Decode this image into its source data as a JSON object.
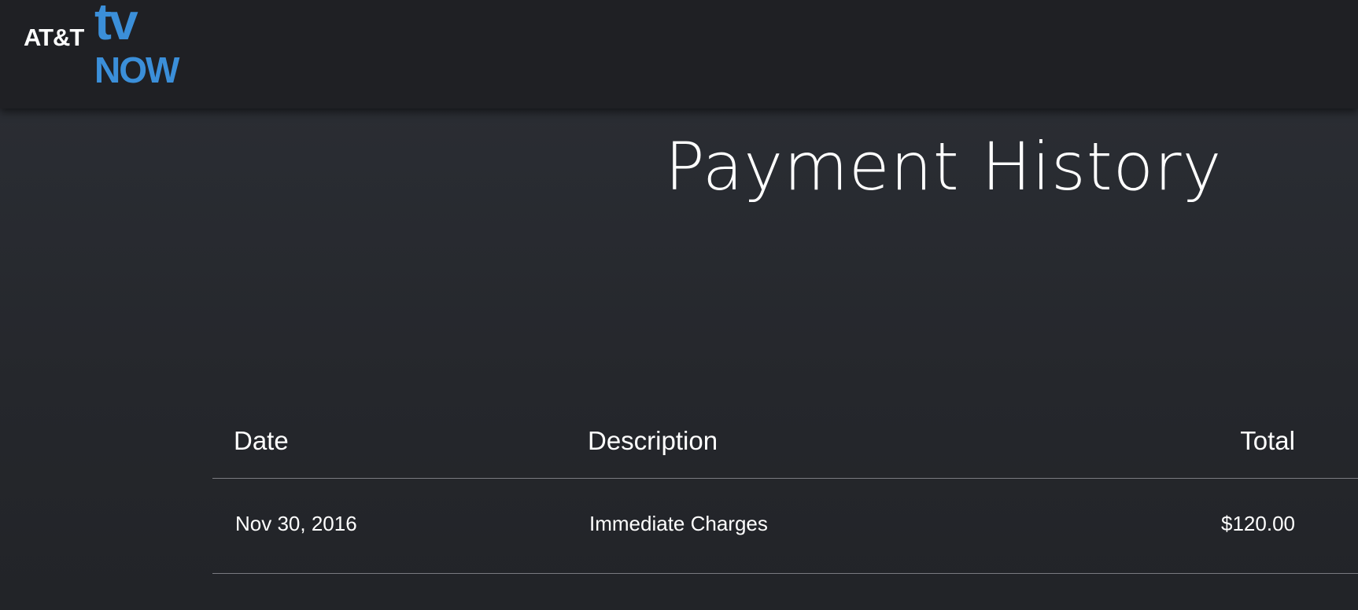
{
  "header": {
    "logo": {
      "att": "AT&T",
      "tv": "tv",
      "now": "NOW"
    }
  },
  "main": {
    "title": "Payment History",
    "table": {
      "columns": [
        "Date",
        "Description",
        "Total"
      ],
      "rows": [
        {
          "date": "Nov 30, 2016",
          "description": "Immediate Charges",
          "total": "$120.00"
        }
      ]
    }
  },
  "colors": {
    "brand_blue": "#3b8fd9",
    "background": "#222428",
    "header_bg": "#1f2024"
  }
}
